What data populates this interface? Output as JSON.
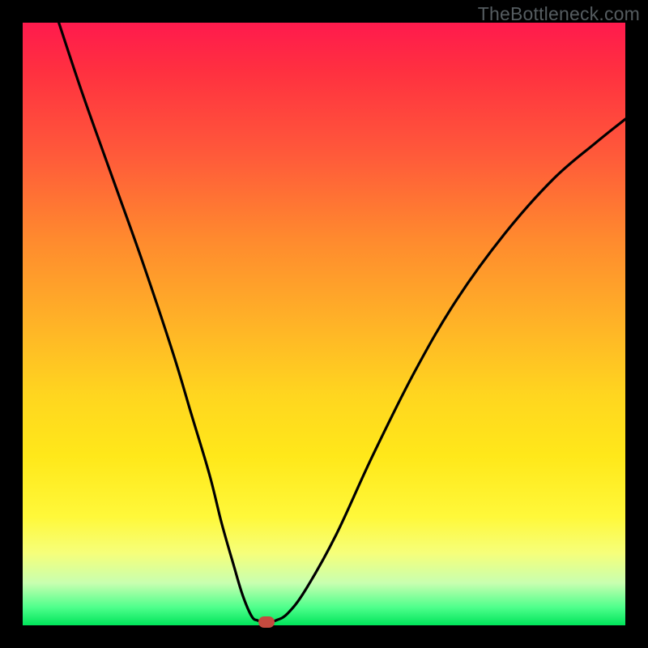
{
  "watermark": "TheBottleneck.com",
  "chart_data": {
    "type": "line",
    "title": "",
    "xlabel": "",
    "ylabel": "",
    "xlim": [
      0,
      100
    ],
    "ylim": [
      0,
      100
    ],
    "series": [
      {
        "name": "bottleneck-curve",
        "x": [
          6,
          10,
          15,
          20,
          25,
          28,
          31,
          33,
          35,
          36.5,
          38,
          39,
          40,
          41,
          42,
          44,
          47,
          52,
          58,
          65,
          72,
          80,
          88,
          95,
          100
        ],
        "y": [
          100,
          88,
          74,
          60,
          45,
          35,
          25,
          17,
          10,
          5,
          1.5,
          0.8,
          0.6,
          0.6,
          0.8,
          2,
          6,
          15,
          28,
          42,
          54,
          65,
          74,
          80,
          84
        ]
      }
    ],
    "marker": {
      "x": 40.5,
      "y": 0.6
    },
    "gradient_stops": [
      {
        "pos": 0,
        "color": "#ff1a4d"
      },
      {
        "pos": 50,
        "color": "#ffb327"
      },
      {
        "pos": 82,
        "color": "#fff83a"
      },
      {
        "pos": 100,
        "color": "#00e45a"
      }
    ]
  }
}
